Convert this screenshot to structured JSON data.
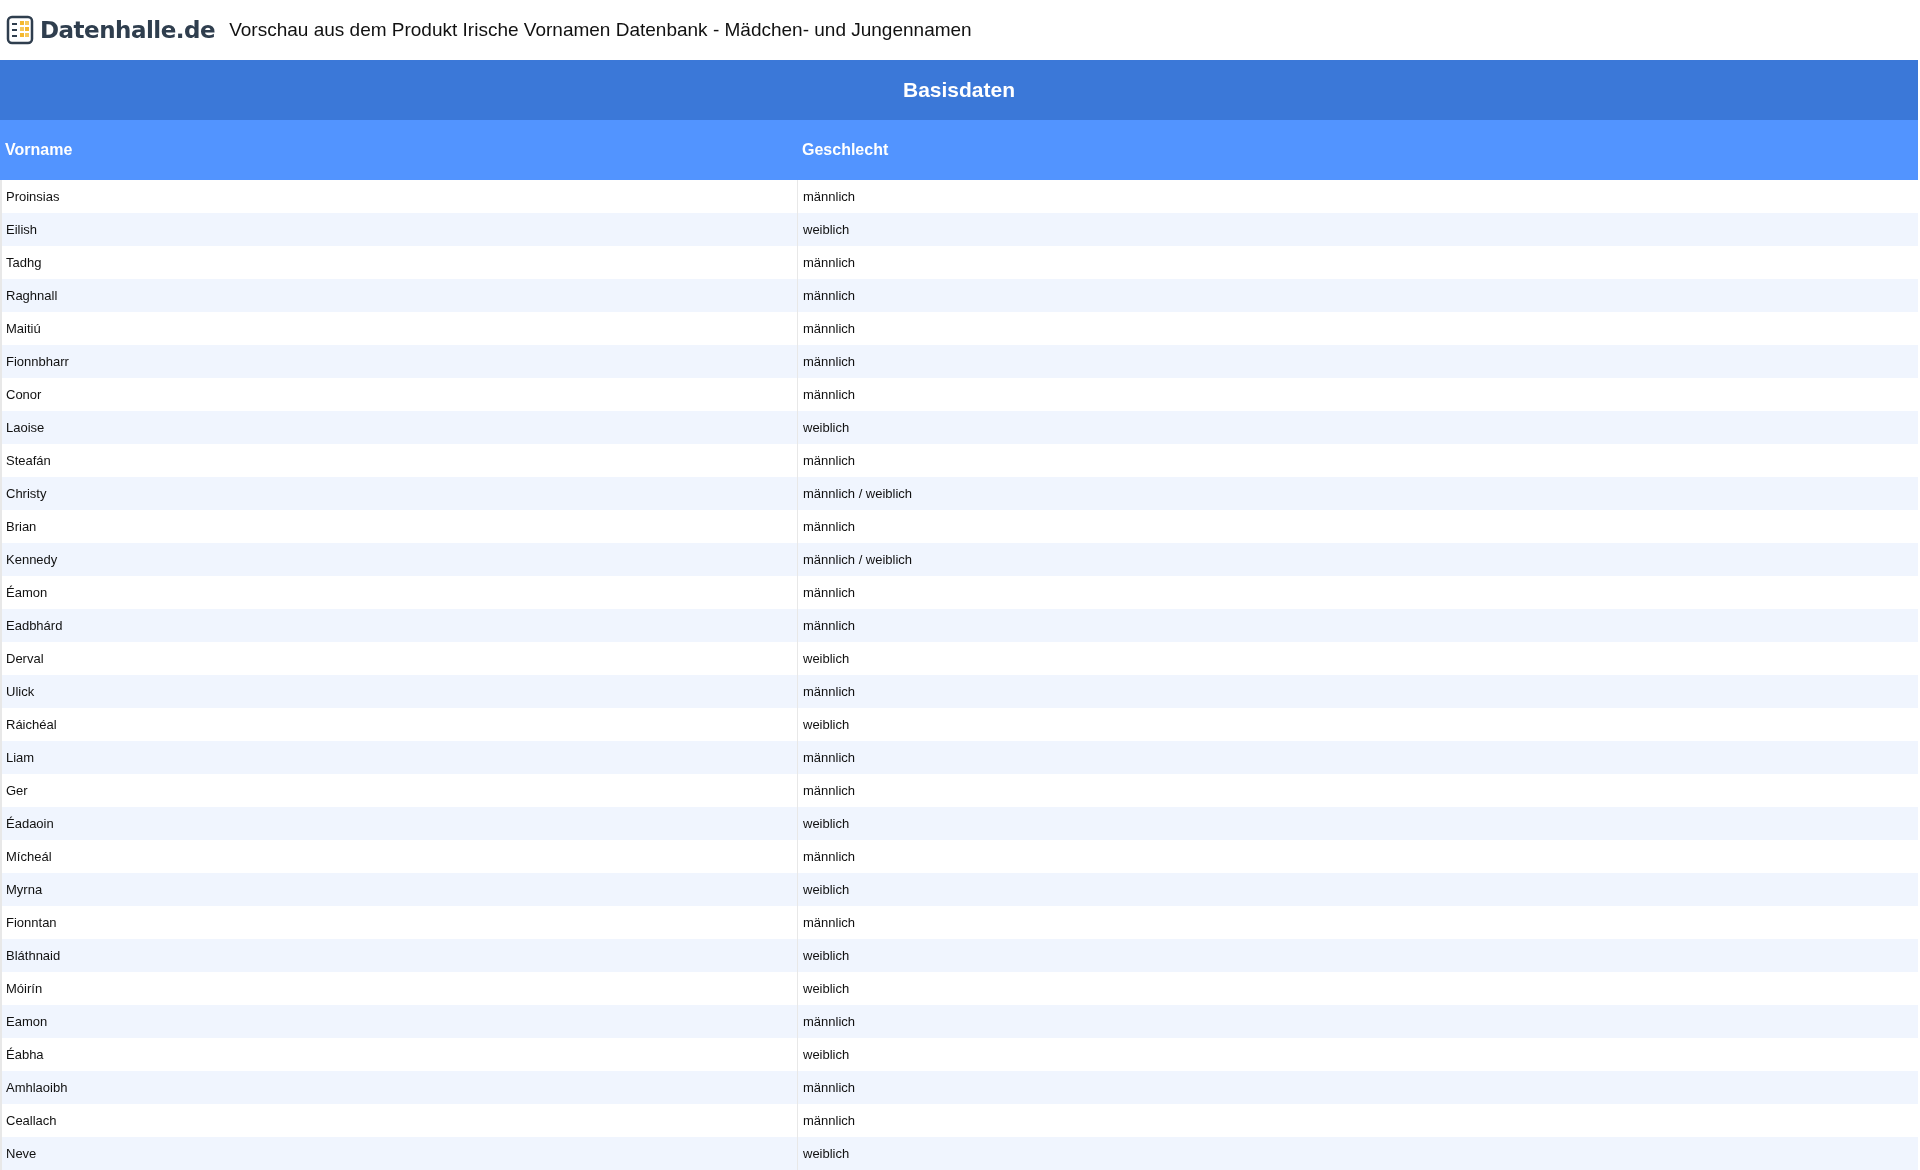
{
  "header": {
    "logo_text": "Datenhalle.de",
    "title": "Vorschau aus dem Produkt Irische Vornamen Datenbank - Mädchen- und Jungennamen"
  },
  "table": {
    "title": "Basisdaten",
    "columns": [
      "Vorname",
      "Geschlecht"
    ],
    "rows": [
      [
        "Proinsias",
        "männlich"
      ],
      [
        "Eilish",
        "weiblich"
      ],
      [
        "Tadhg",
        "männlich"
      ],
      [
        "Raghnall",
        "männlich"
      ],
      [
        "Maitiú",
        "männlich"
      ],
      [
        "Fionnbharr",
        "männlich"
      ],
      [
        "Conor",
        "männlich"
      ],
      [
        "Laoise",
        "weiblich"
      ],
      [
        "Steafán",
        "männlich"
      ],
      [
        "Christy",
        "männlich / weiblich"
      ],
      [
        "Brian",
        "männlich"
      ],
      [
        "Kennedy",
        "männlich / weiblich"
      ],
      [
        "Éamon",
        "männlich"
      ],
      [
        "Eadbhárd",
        "männlich"
      ],
      [
        "Derval",
        "weiblich"
      ],
      [
        "Ulick",
        "männlich"
      ],
      [
        "Ráichéal",
        "weiblich"
      ],
      [
        "Liam",
        "männlich"
      ],
      [
        "Ger",
        "männlich"
      ],
      [
        "Éadaoin",
        "weiblich"
      ],
      [
        "Mícheál",
        "männlich"
      ],
      [
        "Myrna",
        "weiblich"
      ],
      [
        "Fionntan",
        "männlich"
      ],
      [
        "Bláthnaid",
        "weiblich"
      ],
      [
        "Móirín",
        "weiblich"
      ],
      [
        "Eamon",
        "männlich"
      ],
      [
        "Éabha",
        "weiblich"
      ],
      [
        "Amhlaoibh",
        "männlich"
      ],
      [
        "Ceallach",
        "männlich"
      ],
      [
        "Neve",
        "weiblich"
      ]
    ]
  }
}
